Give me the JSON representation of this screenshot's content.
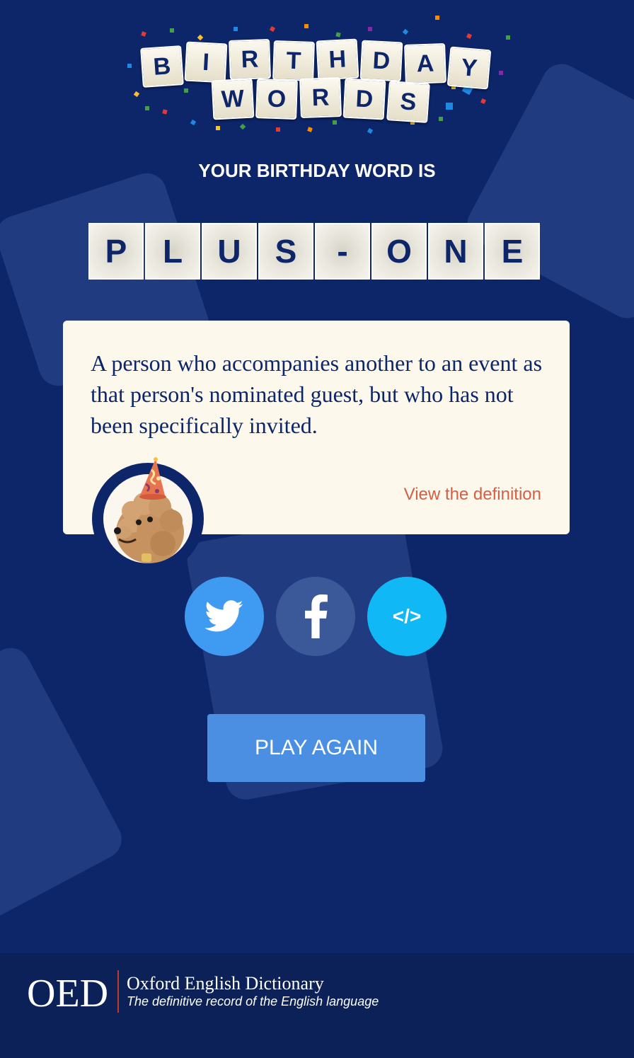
{
  "logo": {
    "row1": [
      "B",
      "I",
      "R",
      "T",
      "H",
      "D",
      "A",
      "Y"
    ],
    "row2": [
      "W",
      "O",
      "R",
      "D",
      "S"
    ]
  },
  "subtitle": "YOUR BIRTHDAY WORD IS",
  "word_tiles": [
    "P",
    "L",
    "U",
    "S",
    "-",
    "O",
    "N",
    "E"
  ],
  "definition": {
    "text": "A person who accompanies another to an event as that person's nominated guest, but who has not been specifically invited.",
    "link_label": "View the definition"
  },
  "social": {
    "twitter_icon": "twitter-icon",
    "facebook_icon": "facebook-icon",
    "embed_label": "</>"
  },
  "play_again_label": "PLAY AGAIN",
  "footer": {
    "mark": "OED",
    "name": "Oxford English Dictionary",
    "tagline": "The definitive record of the English language"
  },
  "colors": {
    "background": "#0d2569",
    "accent_link": "#d75d45",
    "play_button": "#4a8fe2",
    "twitter": "#3f9af2",
    "facebook": "#3b5998",
    "embed": "#10b9f5"
  }
}
